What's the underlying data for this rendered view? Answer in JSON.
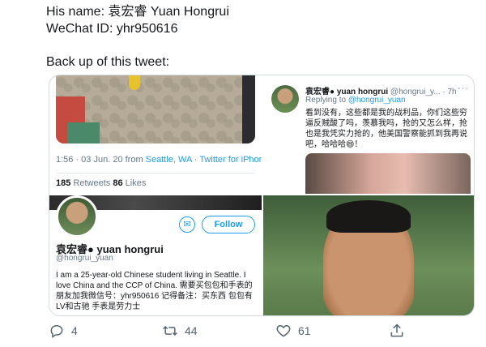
{
  "intro": {
    "name_line": "His name: 袁宏睿 Yuan Hongrui",
    "wechat_line": "WeChat ID: yhr950616",
    "backup_line": "Back up of this tweet:"
  },
  "tweet_panel": {
    "time_date": "1:56 · 03 Jun. 20 from ",
    "location_link": "Seattle, WA",
    "separator": " · ",
    "client_link": "Twitter for iPhone",
    "retweets_count": "185",
    "retweets_label": " Retweets  ",
    "likes_count": "86",
    "likes_label": " Likes"
  },
  "reply_panel": {
    "name": "袁宏睿",
    "name_latin": " yuan hongrui",
    "handle": " @hongrui_y... · 7h",
    "more": "···",
    "replying_prefix": "Replying to ",
    "replying_to": "@hongrui_yuan",
    "text": "看到没有，这些都是我的战利品，你们这些穷逼反贼酸了吗，羡慕我吗，抢的又怎么样，抢也是我凭实力抢的，他美国警察能抓到我再说吧，哈哈哈😄！"
  },
  "profile_panel": {
    "follow_label": "Follow",
    "mail_icon": "envelope-icon",
    "name": "袁宏睿",
    "name_latin": " yuan hongrui",
    "handle": "@hongrui_yuan",
    "bio": "I am a 25-year-old Chinese student living in Seattle. I love China and the CCP of China. 需要买包包和手表的朋友加我微信号：yhr950616 记得备注：买东西 包包有LV和古驰 手表是劳力士"
  },
  "actions": {
    "reply_count": "4",
    "retweet_count": "44",
    "like_count": "61"
  },
  "colors": {
    "link": "#1d9bf0",
    "muted": "#657786",
    "text": "#14171a"
  }
}
